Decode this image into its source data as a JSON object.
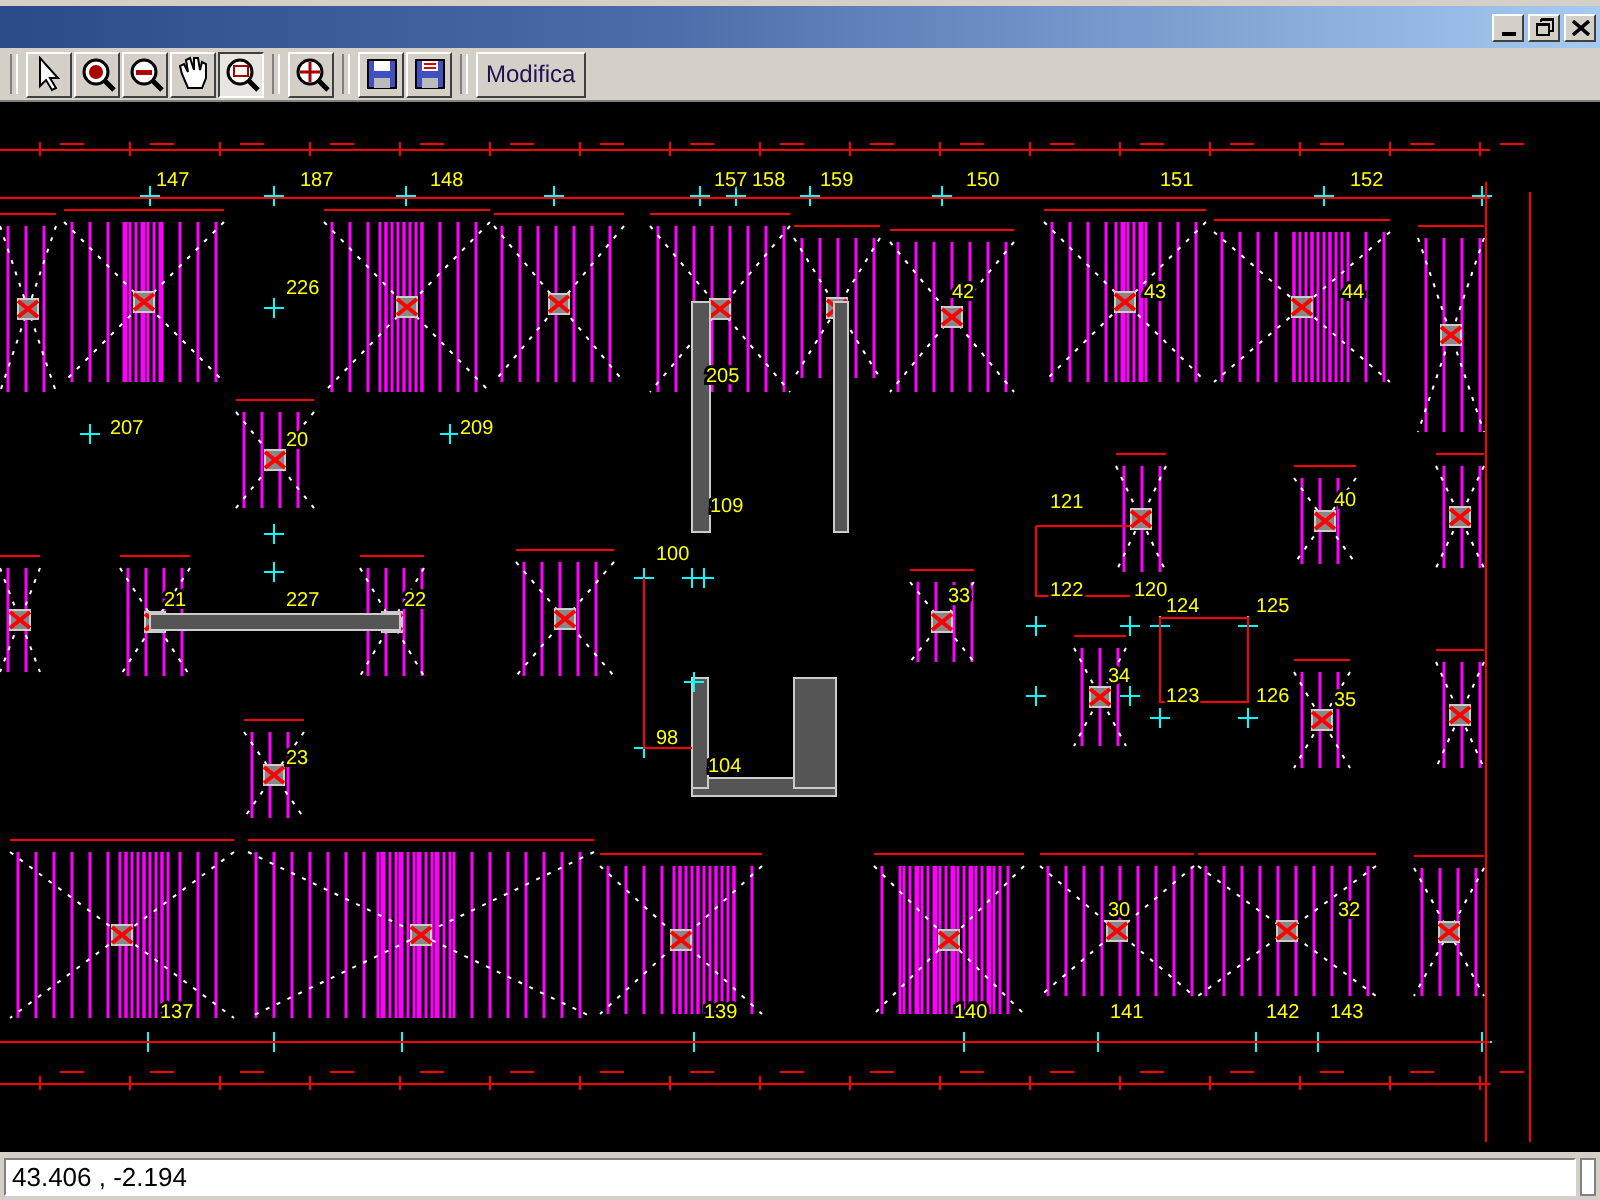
{
  "window": {
    "controls": [
      {
        "kind": "minimize"
      },
      {
        "kind": "restore"
      },
      {
        "kind": "close"
      }
    ]
  },
  "toolbar": {
    "tools": [
      {
        "kind": "pointer",
        "selected": false
      },
      {
        "kind": "zoom_in",
        "selected": false
      },
      {
        "kind": "zoom_out",
        "selected": false
      },
      {
        "kind": "pan",
        "selected": false
      },
      {
        "kind": "zoom_window",
        "selected": true
      },
      {
        "kind": "zoom_extents",
        "selected": false
      },
      {
        "kind": "save",
        "selected": false
      },
      {
        "kind": "save_as",
        "selected": false
      }
    ],
    "button": "Modifica"
  },
  "drawing": {
    "labels": [
      "147",
      "187",
      "148",
      "157",
      "158",
      "159",
      "150",
      "151",
      "152",
      "226",
      "207",
      "209",
      "205",
      "109",
      "100",
      "121",
      "122",
      "120",
      "124",
      "125",
      "123",
      "126",
      "227",
      "98",
      "104",
      "137",
      "139",
      "140",
      "141",
      "142",
      "143",
      "20",
      "33",
      "34",
      "40",
      "35",
      "23",
      "21",
      "22",
      "42",
      "43",
      "44",
      "30",
      "32"
    ]
  },
  "status_bar": {
    "coordinates": "43.406 , -2.194"
  }
}
